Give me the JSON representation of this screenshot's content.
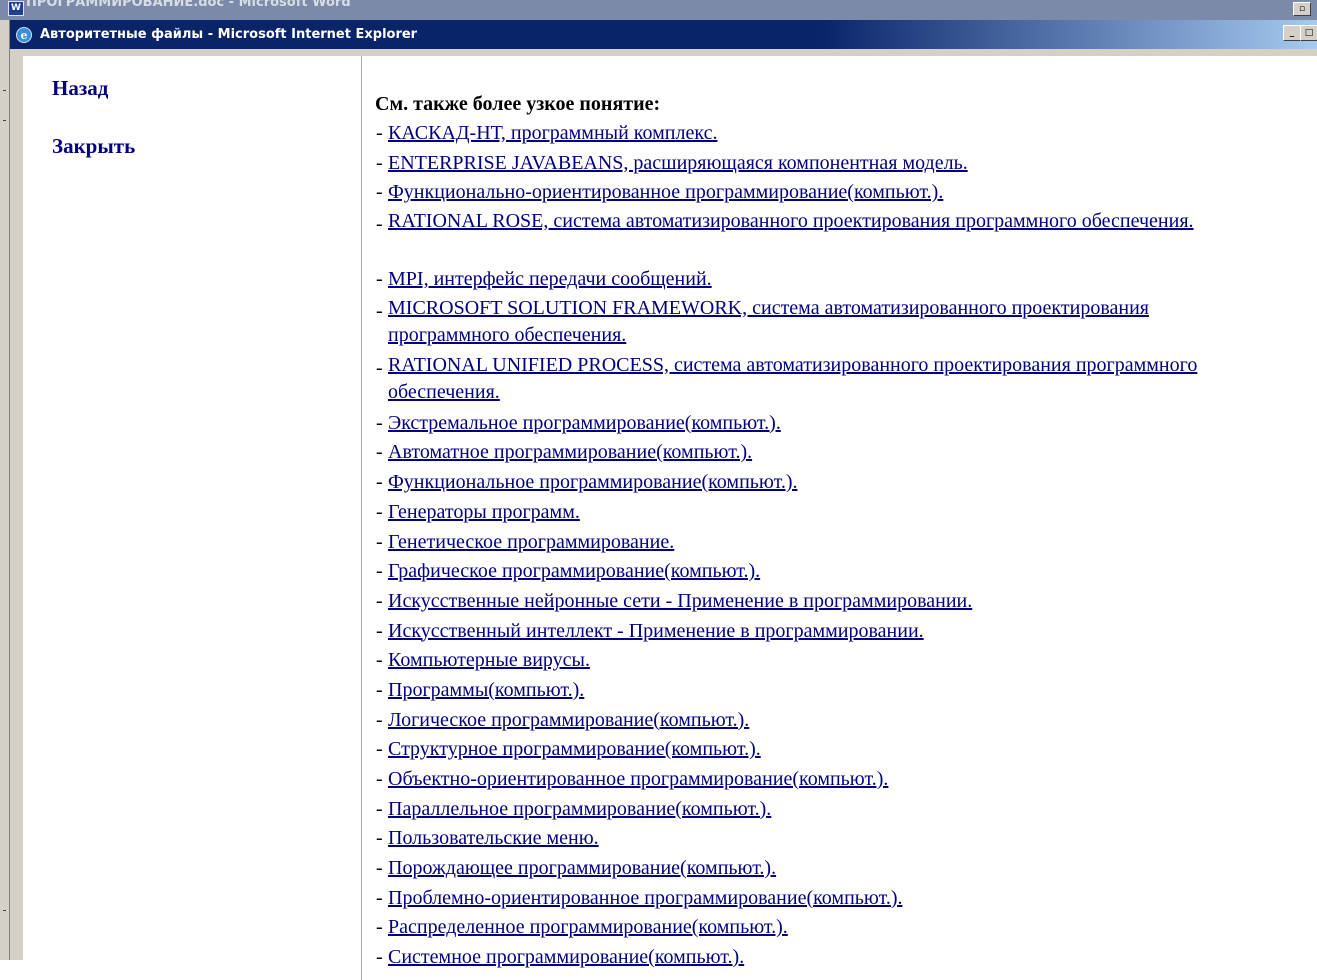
{
  "word_window": {
    "title": "ПРОГРАММИРОВАНИЕ.doc - Microsoft Word",
    "icon": "word-app-icon",
    "restore_label": "▫"
  },
  "ie_window": {
    "title": "Авторитетные файлы - Microsoft Internet Explorer",
    "icon": "ie-app-icon",
    "minimize_label": "_",
    "maximize_label": "□"
  },
  "nav": {
    "back": "Назад",
    "close": "Закрыть"
  },
  "content": {
    "heading": "См. также более узкое понятие:",
    "bullet": "-",
    "items": [
      {
        "label": "КАСКАД-НТ, программный комплекс."
      },
      {
        "label": "ENTERPRISE JAVABEANS, расширяющаяся компонентная модель."
      },
      {
        "label": "Функционально-ориентированное программирование(компьют.)."
      },
      {
        "label": "RATIONAL ROSE, система автоматизированного проектирования программного обеспечения."
      },
      {
        "label": "MPI, интерфейс передачи сообщений."
      },
      {
        "label": "MICROSOFT SOLUTION FRAMEWORK, система автоматизированного проектирования программного обеспечения."
      },
      {
        "label": "RATIONAL UNIFIED PROCESS, система автоматизированного проектирования программного обеспечения."
      },
      {
        "label": "Экстремальное программирование(компьют.)."
      },
      {
        "label": "Автоматное программирование(компьют.)."
      },
      {
        "label": "Функциональное программирование(компьют.)."
      },
      {
        "label": "Генераторы программ."
      },
      {
        "label": "Генетическое программирование."
      },
      {
        "label": "Графическое программирование(компьют.)."
      },
      {
        "label": "Искусственные нейронные сети - Применение в программировании."
      },
      {
        "label": "Искусственный интеллект - Применение в программировании."
      },
      {
        "label": "Компьютерные вирусы."
      },
      {
        "label": "Программы(компьют.)."
      },
      {
        "label": "Логическое программирование(компьют.)."
      },
      {
        "label": "Структурное программирование(компьют.)."
      },
      {
        "label": "Объектно-ориентированное программирование(компьют.)."
      },
      {
        "label": "Параллельное программирование(компьют.)."
      },
      {
        "label": "Пользовательские меню."
      },
      {
        "label": "Порождающее программирование(компьют.)."
      },
      {
        "label": "Проблемно-ориентированное программирование(компьют.)."
      },
      {
        "label": "Распределенное программирование(компьют.)."
      },
      {
        "label": "Системное программирование(компьют.)."
      }
    ]
  },
  "colors": {
    "link": "#000080",
    "titlebar": "#0a246a",
    "window": "#d4d0c8"
  }
}
